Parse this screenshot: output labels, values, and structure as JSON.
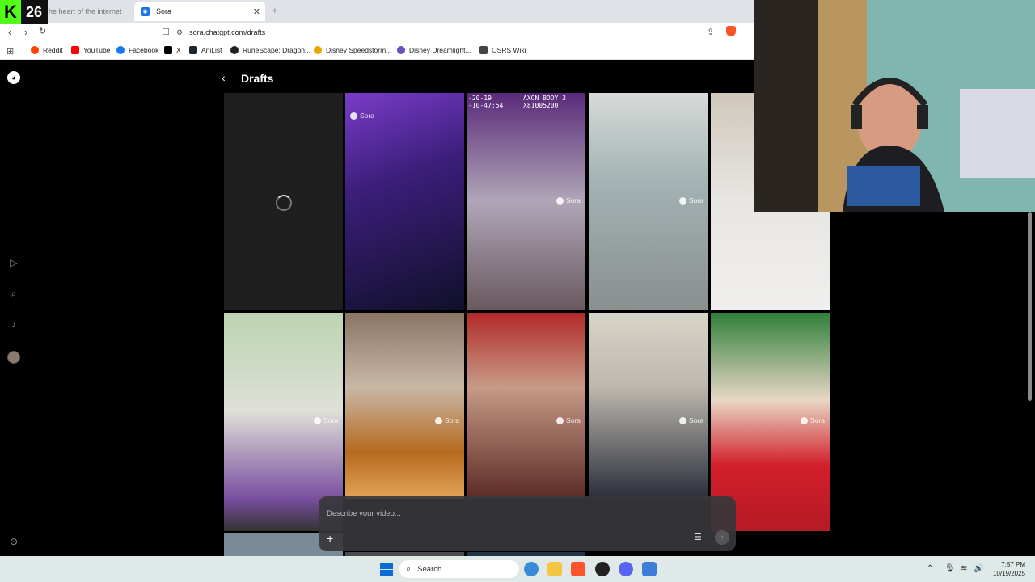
{
  "overlay": {
    "badge_number": "26"
  },
  "browser": {
    "tabs": [
      {
        "label": "he heart of the internet"
      },
      {
        "label": "Sora"
      }
    ],
    "url": "sora.chatgpt.com/drafts",
    "bookmarks": [
      {
        "label": "Reddit",
        "color": "#ff4500"
      },
      {
        "label": "YouTube",
        "color": "#ff0000"
      },
      {
        "label": "Facebook",
        "color": "#1877f2"
      },
      {
        "label": "X",
        "color": "#000000"
      },
      {
        "label": "AniList",
        "color": "#1e2630"
      },
      {
        "label": "RuneScape: Dragon...",
        "color": "#222222"
      },
      {
        "label": "Disney Speedstorm...",
        "color": "#e6a700"
      },
      {
        "label": "Disney Dreamlight...",
        "color": "#6a4fc0"
      },
      {
        "label": "OSRS Wiki",
        "color": "#444444"
      }
    ]
  },
  "app": {
    "title": "Drafts",
    "watermark": "Sora",
    "tile_overlay_text": "-20-19\n-10-47:54",
    "tile_overlay_text2": "AXON BODY 3\nX81005200",
    "composer": {
      "placeholder": "Describe your video..."
    },
    "tiles": [
      {
        "state": "loading",
        "bg": "#1f1f1f"
      },
      {
        "bg": "linear-gradient(160deg,#7a3cc9 0%,#3b1e7a 40%,#10102a 100%)",
        "wm": "top"
      },
      {
        "bg": "linear-gradient(180deg,#5a2a7a 0%,#b0a6b8 50%,#6a5a60 100%)",
        "overlay": true
      },
      {
        "bg": "linear-gradient(180deg,#d8dbd9 0%,#a4b3b4 40%,#8a8f90 100%)"
      },
      {
        "bg": "linear-gradient(180deg,#cfc7bb 0%,#e8e6e3 50%,#f0efed 100%)"
      },
      {
        "bg": "linear-gradient(180deg,#bcd5b0 0%,#dfe0d8 45%,#7a4fa0 85%,#333 100%)"
      },
      {
        "bg": "linear-gradient(180deg,#8a7565 0%,#c9b7a6 40%,#b66a1f 75%,#e3a45a 100%)"
      },
      {
        "bg": "linear-gradient(180deg,#b22a2a 0%,#c79a86 40%,#5c2a25 100%)"
      },
      {
        "bg": "linear-gradient(180deg,#d9d4c8 0%,#bcb8ae 40%,#2a2d3a 100%)"
      },
      {
        "bg": "linear-gradient(180deg,#2f7f3a 0%,#e8d7c5 40%,#d21f2a 70%,#b51a25 100%)"
      }
    ]
  },
  "taskbar": {
    "search_label": "Search",
    "time": "7:57 PM",
    "date": "10/19/2025"
  }
}
